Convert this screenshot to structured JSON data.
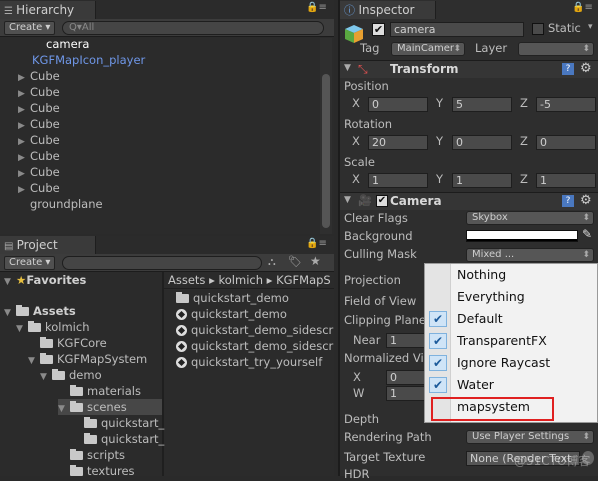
{
  "hierarchy": {
    "tab": "Hierarchy",
    "create": "Create",
    "search_placeholder": "Q▾All",
    "items": [
      {
        "label": "camera",
        "selected": true
      },
      {
        "label": "KGFMapIcon_player",
        "prefab": true
      },
      {
        "label": "Cube"
      },
      {
        "label": "Cube"
      },
      {
        "label": "Cube"
      },
      {
        "label": "Cube"
      },
      {
        "label": "Cube"
      },
      {
        "label": "Cube"
      },
      {
        "label": "Cube"
      },
      {
        "label": "Cube"
      },
      {
        "label": "groundplane"
      }
    ]
  },
  "project": {
    "tab": "Project",
    "create": "Create",
    "favorites": "Favorites",
    "assets": "Assets",
    "tree": [
      "kolmich",
      "KGFCore",
      "KGFMapSystem",
      "demo",
      "materials",
      "scenes",
      "quickstart_",
      "quickstart_",
      "scripts",
      "textures"
    ],
    "breadcrumb": "Assets ▸ kolmich ▸ KGFMapS",
    "files": [
      "quickstart_demo",
      "quickstart_demo",
      "quickstart_demo_sidescr",
      "quickstart_demo_sidescr",
      "quickstart_try_yourself"
    ]
  },
  "inspector": {
    "tab": "Inspector",
    "object_name": "camera",
    "static_label": "Static",
    "tag_label": "Tag",
    "tag_value": "MainCamer",
    "layer_label": "Layer",
    "transform": {
      "title": "Transform",
      "position_label": "Position",
      "rotation_label": "Rotation",
      "scale_label": "Scale",
      "position": {
        "x": "0",
        "y": "5",
        "z": "-5"
      },
      "rotation": {
        "x": "20",
        "y": "0",
        "z": "0"
      },
      "scale": {
        "x": "1",
        "y": "1",
        "z": "1"
      },
      "x": "X",
      "y": "Y",
      "z": "Z"
    },
    "camera": {
      "title": "Camera",
      "clear_flags_label": "Clear Flags",
      "clear_flags_value": "Skybox",
      "background_label": "Background",
      "culling_mask_label": "Culling Mask",
      "culling_mask_value": "Mixed ...",
      "projection_label": "Projection",
      "fov_label": "Field of View",
      "clipping_label": "Clipping Plane",
      "near_label": "Near",
      "near_value": "1",
      "viewport_label": "Normalized Vi",
      "vx_label": "X",
      "vx_value": "0",
      "vw_label": "W",
      "vw_value": "1",
      "depth_label": "Depth",
      "rendering_path_label": "Rendering Path",
      "rendering_path_value": "Use Player Settings",
      "target_texture_label": "Target Texture",
      "target_texture_value": "None (Render Text",
      "hdr_label": "HDR"
    }
  },
  "culling_menu": {
    "items": [
      {
        "label": "Nothing",
        "checked": false
      },
      {
        "label": "Everything",
        "checked": false
      },
      {
        "label": "Default",
        "checked": true
      },
      {
        "label": "TransparentFX",
        "checked": true
      },
      {
        "label": "Ignore Raycast",
        "checked": true
      },
      {
        "label": "Water",
        "checked": true
      },
      {
        "label": "mapsystem",
        "checked": false
      }
    ]
  },
  "watermark": "@51CTO博客"
}
